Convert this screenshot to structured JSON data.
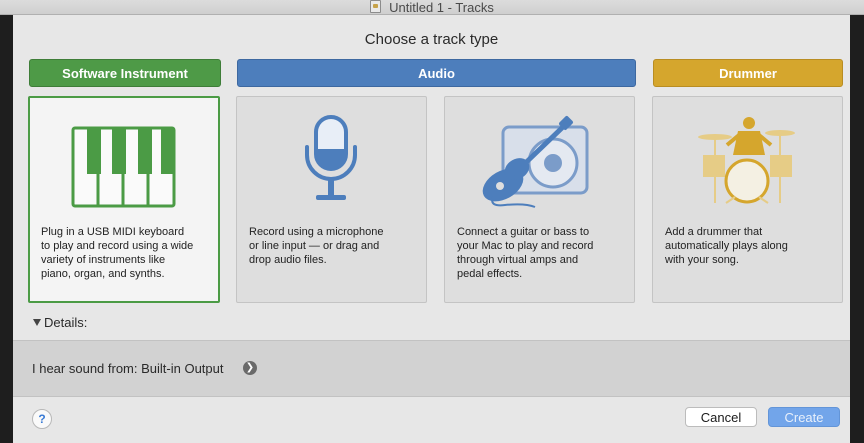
{
  "window": {
    "title": "Untitled 1 - Tracks"
  },
  "dialog": {
    "heading": "Choose a track type",
    "categories": [
      {
        "label": "Software Instrument",
        "color": "#4e9a47"
      },
      {
        "label": "Audio",
        "color": "#4d7ebc"
      },
      {
        "label": "Drummer",
        "color": "#d5a62d"
      }
    ],
    "cards": [
      {
        "icon": "piano-keys-icon",
        "selected": true,
        "lines": [
          "Plug in a USB MIDI keyboard",
          "to play and record using a wide",
          "variety of instruments like",
          "piano, organ, and synths."
        ]
      },
      {
        "icon": "microphone-icon",
        "selected": false,
        "lines": [
          "Record using a microphone",
          "or line input — or drag and",
          "drop audio files."
        ]
      },
      {
        "icon": "guitar-amp-icon",
        "selected": false,
        "lines": [
          "Connect a guitar or bass to",
          "your Mac to play and record",
          "through virtual amps and",
          "pedal effects."
        ]
      },
      {
        "icon": "drum-kit-icon",
        "selected": false,
        "lines": [
          "Add a drummer that",
          "automatically plays along",
          "with your song."
        ]
      }
    ],
    "details_label": "Details:",
    "output_label": "I hear sound from: Built-in Output",
    "help_label": "?",
    "cancel_label": "Cancel",
    "create_label": "Create"
  }
}
